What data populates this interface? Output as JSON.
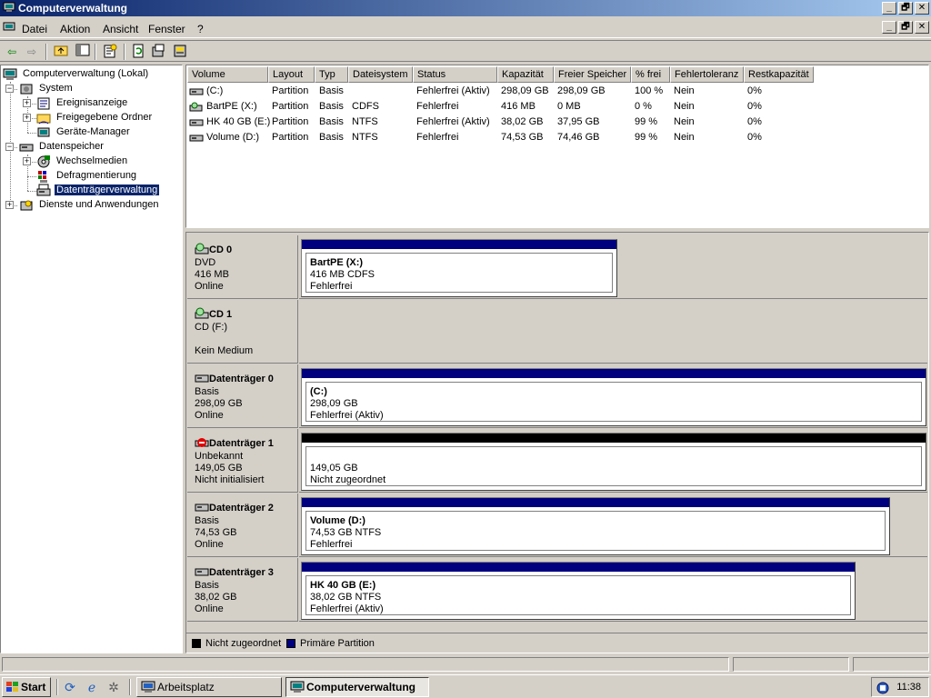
{
  "window": {
    "title": "Computerverwaltung",
    "caption_buttons": [
      "_",
      "🗗",
      "✕"
    ]
  },
  "menu": {
    "items": [
      "Datei",
      "Aktion",
      "Ansicht",
      "Fenster",
      "?"
    ]
  },
  "toolbar": {
    "icons": [
      "back-arrow-icon",
      "forward-arrow-icon",
      "up-folder-icon",
      "show-tree-icon",
      "export-list-icon",
      "refresh-icon",
      "properties-icon",
      "help-icon"
    ]
  },
  "tree": {
    "root": "Computerverwaltung (Lokal)",
    "system": "System",
    "ereignisanzeige": "Ereignisanzeige",
    "freigegebene": "Freigegebene Ordner",
    "geraete": "Geräte-Manager",
    "datenspeicher": "Datenspeicher",
    "wechselmedien": "Wechselmedien",
    "defrag": "Defragmentierung",
    "dtv": "Datenträgerverwaltung",
    "dienste": "Dienste und Anwendungen",
    "expander_plus": "+",
    "expander_minus": "−"
  },
  "volumes": {
    "headers": [
      "Volume",
      "Layout",
      "Typ",
      "Dateisystem",
      "Status",
      "Kapazität",
      "Freier Speicher",
      "% frei",
      "Fehlertoleranz",
      "Restkapazität"
    ],
    "rows": [
      [
        "(C:)",
        "Partition",
        "Basis",
        "",
        "Fehlerfrei (Aktiv)",
        "298,09 GB",
        "298,09 GB",
        "100 %",
        "Nein",
        "0%"
      ],
      [
        "BartPE (X:)",
        "Partition",
        "Basis",
        "CDFS",
        "Fehlerfrei",
        "416 MB",
        "0 MB",
        "0 %",
        "Nein",
        "0%"
      ],
      [
        "HK 40 GB (E:)",
        "Partition",
        "Basis",
        "NTFS",
        "Fehlerfrei (Aktiv)",
        "38,02 GB",
        "37,95 GB",
        "99 %",
        "Nein",
        "0%"
      ],
      [
        "Volume (D:)",
        "Partition",
        "Basis",
        "NTFS",
        "Fehlerfrei",
        "74,53 GB",
        "74,46 GB",
        "99 %",
        "Nein",
        "0%"
      ]
    ]
  },
  "disks": [
    {
      "name": "CD 0",
      "line1": "DVD",
      "line2": "416 MB",
      "line3": "Online",
      "part_title": "BartPE  (X:)",
      "part_line2": "416 MB CDFS",
      "part_line3": "Fehlerfrei",
      "bar_color": "#00007f"
    },
    {
      "name": "CD 1",
      "line1": "CD (F:)",
      "line2": "",
      "line3": "Kein Medium"
    },
    {
      "name": "Datenträger 0",
      "line1": "Basis",
      "line2": "298,09 GB",
      "line3": "Online",
      "part_title": " (C:)",
      "part_line2": "298,09 GB",
      "part_line3": "Fehlerfrei (Aktiv)",
      "bar_color": "#00007f"
    },
    {
      "name": "Datenträger 1",
      "line1": "Unbekannt",
      "line2": "149,05 GB",
      "line3": "Nicht initialisiert",
      "part_title": "",
      "part_line2": "149,05 GB",
      "part_line3": "Nicht zugeordnet",
      "bar_color": "#000000"
    },
    {
      "name": "Datenträger 2",
      "line1": "Basis",
      "line2": "74,53 GB",
      "line3": "Online",
      "part_title": "Volume  (D:)",
      "part_line2": "74,53 GB NTFS",
      "part_line3": "Fehlerfrei",
      "bar_color": "#00007f"
    },
    {
      "name": "Datenträger 3",
      "line1": "Basis",
      "line2": "38,02 GB",
      "line3": "Online",
      "part_title": "HK 40 GB  (E:)",
      "part_line2": "38,02 GB NTFS",
      "part_line3": "Fehlerfrei (Aktiv)",
      "bar_color": "#00007f"
    }
  ],
  "legend": {
    "unallocated": "Nicht zugeordnet",
    "unallocated_color": "#000000",
    "primary": "Primäre Partition",
    "primary_color": "#00007f"
  },
  "taskbar": {
    "start": "Start",
    "task1": "Arbeitsplatz",
    "task2": "Computerverwaltung",
    "clock": "11:38"
  }
}
